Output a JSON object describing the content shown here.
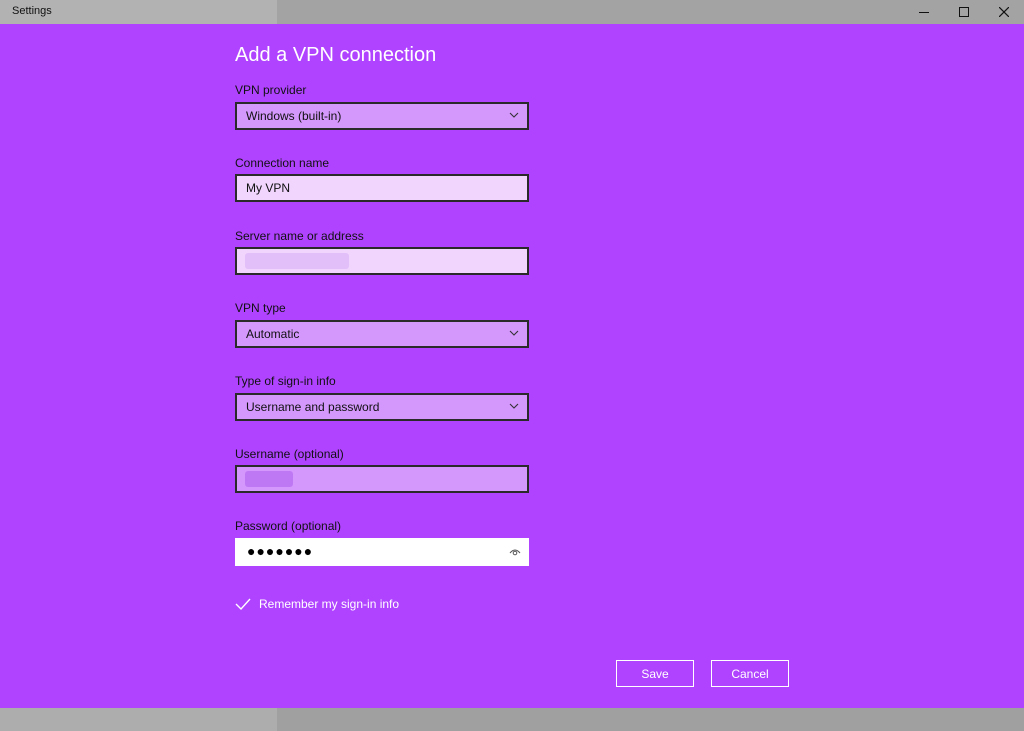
{
  "window": {
    "title": "Settings",
    "controls": {
      "minimize": "minimize-icon",
      "maximize": "maximize-icon",
      "close": "close-icon"
    }
  },
  "colors": {
    "dialog_background": "#b043ff",
    "select_background": "#d497fc",
    "text_background": "#f1d5fd"
  },
  "form": {
    "heading": "Add a VPN connection",
    "vpn_provider": {
      "label": "VPN provider",
      "value": "Windows (built-in)"
    },
    "connection_name": {
      "label": "Connection name",
      "value": "My VPN"
    },
    "server": {
      "label": "Server name or address",
      "value": ""
    },
    "vpn_type": {
      "label": "VPN type",
      "value": "Automatic"
    },
    "signin_type": {
      "label": "Type of sign-in info",
      "value": "Username and password"
    },
    "username": {
      "label": "Username (optional)",
      "value": ""
    },
    "password": {
      "label": "Password (optional)",
      "value": "●●●●●●●",
      "reveal_icon": "eye-icon"
    },
    "remember": {
      "label": "Remember my sign-in info",
      "checked": true
    }
  },
  "buttons": {
    "save": "Save",
    "cancel": "Cancel"
  }
}
